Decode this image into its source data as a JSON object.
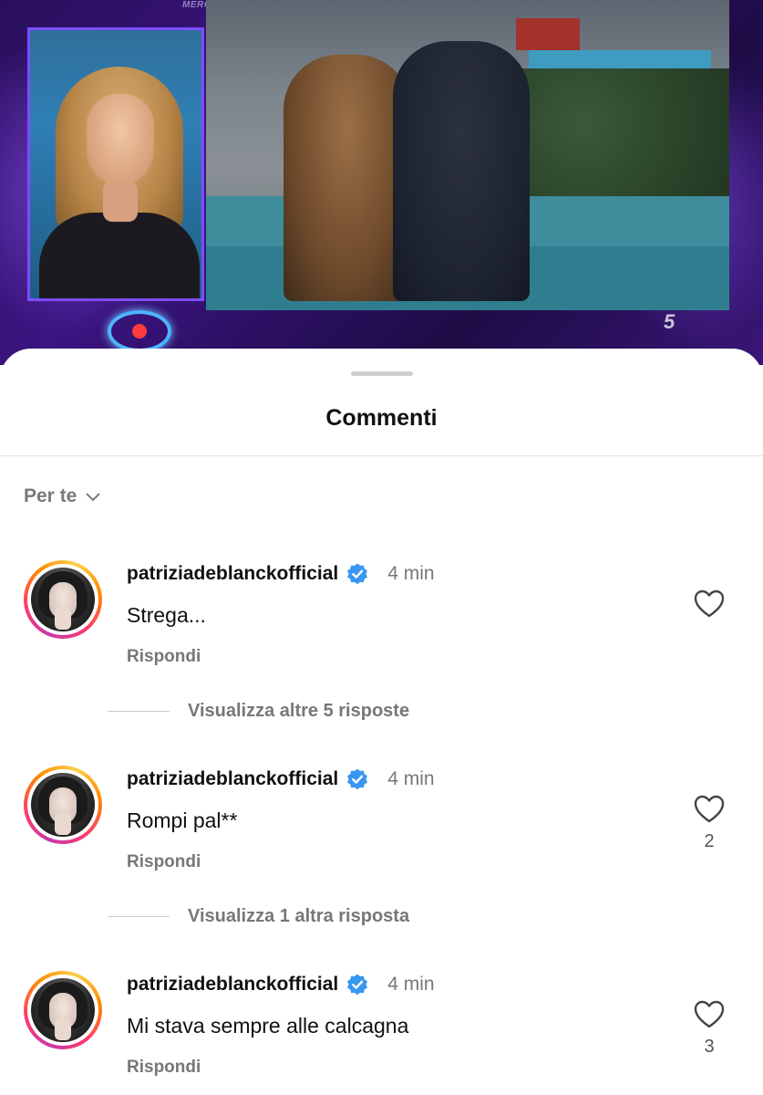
{
  "video": {
    "top_caption": "MERCOLEDÌ IN PRIMA SERATA",
    "channel_logo": "5"
  },
  "sheet": {
    "title": "Commenti",
    "sort_label": "Per te"
  },
  "comments": [
    {
      "username": "patriziadeblanckofficial",
      "time": "4 min",
      "text": "Strega...",
      "reply_label": "Rispondi",
      "likes": "",
      "more_replies": "Visualizza altre 5 risposte"
    },
    {
      "username": "patriziadeblanckofficial",
      "time": "4 min",
      "text": "Rompi pal**",
      "reply_label": "Rispondi",
      "likes": "2",
      "more_replies": "Visualizza 1 altra risposta"
    },
    {
      "username": "patriziadeblanckofficial",
      "time": "4 min",
      "text": "Mi stava sempre alle calcagna",
      "reply_label": "Rispondi",
      "likes": "3",
      "more_replies": ""
    }
  ],
  "colors": {
    "verified": "#3897f0",
    "text_primary": "#111111",
    "text_secondary": "#777777"
  }
}
